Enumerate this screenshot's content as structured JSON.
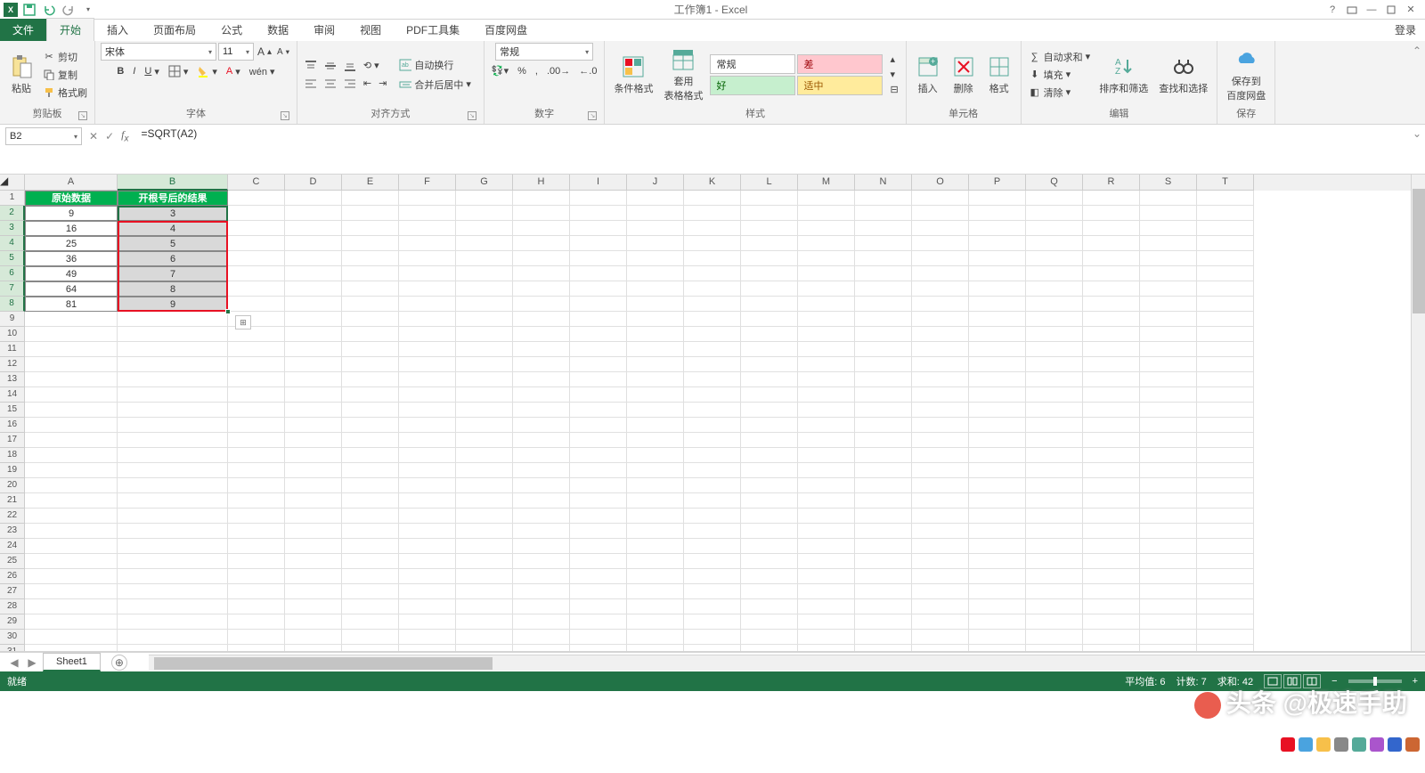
{
  "title": "工作簿1 - Excel",
  "login_label": "登录",
  "tabs": {
    "file": "文件",
    "home": "开始",
    "insert": "插入",
    "layout": "页面布局",
    "formulas": "公式",
    "data": "数据",
    "review": "审阅",
    "view": "视图",
    "pdf": "PDF工具集",
    "baidu": "百度网盘"
  },
  "ribbon": {
    "clipboard": {
      "paste": "粘贴",
      "cut": "剪切",
      "copy": "复制",
      "format_painter": "格式刷",
      "label": "剪贴板"
    },
    "font": {
      "name": "宋体",
      "size": "11",
      "label": "字体"
    },
    "align": {
      "wrap": "自动换行",
      "merge": "合并后居中",
      "label": "对齐方式"
    },
    "number": {
      "format": "常规",
      "label": "数字"
    },
    "styles": {
      "cond": "条件格式",
      "table": "套用\n表格格式",
      "normal": "常规",
      "bad": "差",
      "good": "好",
      "neutral": "适中",
      "label": "样式"
    },
    "cells": {
      "insert": "插入",
      "delete": "删除",
      "format": "格式",
      "label": "单元格"
    },
    "editing": {
      "autosum": "自动求和",
      "fill": "填充",
      "clear": "清除",
      "sort": "排序和筛选",
      "find": "查找和选择",
      "label": "编辑"
    },
    "save": {
      "baidu": "保存到\n百度网盘",
      "label": "保存"
    }
  },
  "namebox": "B2",
  "formula": "=SQRT(A2)",
  "columns": [
    "A",
    "B",
    "C",
    "D",
    "E",
    "F",
    "G",
    "H",
    "I",
    "J",
    "K",
    "L",
    "M",
    "N",
    "O",
    "P",
    "Q",
    "R",
    "S",
    "T"
  ],
  "col_widths": {
    "A": 104,
    "B": 124,
    "default": 64
  },
  "selected_cols": [
    "B"
  ],
  "selected_rows": [
    2,
    3,
    4,
    5,
    6,
    7,
    8
  ],
  "headers": {
    "A": "原始数据",
    "B": "开根号后的结果"
  },
  "data_rows": [
    {
      "A": "9",
      "B": "3"
    },
    {
      "A": "16",
      "B": "4"
    },
    {
      "A": "25",
      "B": "5"
    },
    {
      "A": "36",
      "B": "6"
    },
    {
      "A": "49",
      "B": "7"
    },
    {
      "A": "64",
      "B": "8"
    },
    {
      "A": "81",
      "B": "9"
    }
  ],
  "total_rows": 31,
  "sheet": "Sheet1",
  "status": {
    "ready": "就绪",
    "avg": "平均值: 6",
    "count": "计数: 7",
    "sum": "求和: 42"
  },
  "watermark": "头条 @极速手助"
}
